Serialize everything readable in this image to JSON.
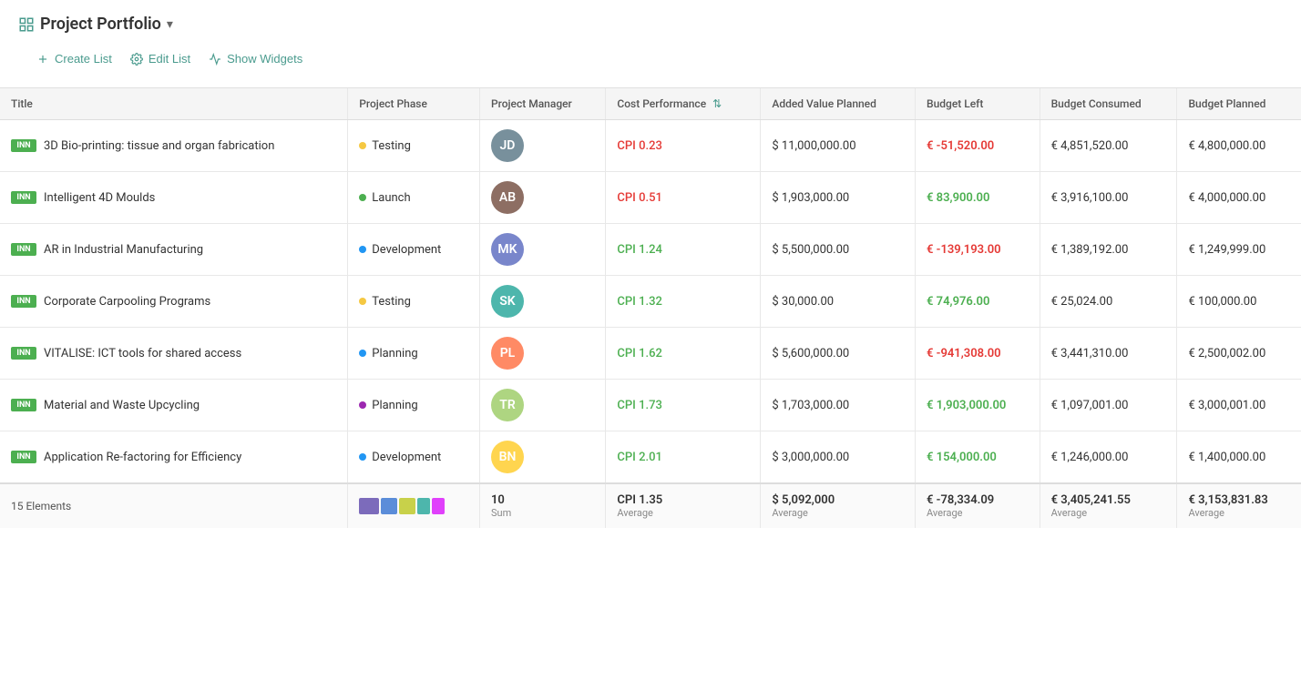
{
  "header": {
    "title": "Project Portfolio",
    "icon": "📋"
  },
  "toolbar": {
    "create_list": "Create List",
    "edit_list": "Edit List",
    "show_widgets": "Show Widgets"
  },
  "table": {
    "columns": [
      "Title",
      "Project Phase",
      "Project Manager",
      "Cost Performance",
      "Added Value Planned",
      "Budget Left",
      "Budget Consumed",
      "Budget Planned"
    ],
    "rows": [
      {
        "id": 1,
        "badge": "INN",
        "title": "3D Bio-printing: tissue and organ fabrication",
        "phase": "Testing",
        "phase_dot": "yellow",
        "cpi": "CPI 0.23",
        "cpi_color": "red",
        "added_value": "$ 11,000,000.00",
        "budget_left": "€ -51,520.00",
        "budget_left_color": "red",
        "budget_consumed": "€ 4,851,520.00",
        "budget_planned": "€ 4,800,000.00",
        "avatar_initials": "JD"
      },
      {
        "id": 2,
        "badge": "INN",
        "title": "Intelligent 4D Moulds",
        "phase": "Launch",
        "phase_dot": "green",
        "cpi": "CPI 0.51",
        "cpi_color": "red",
        "added_value": "$ 1,903,000.00",
        "budget_left": "€ 83,900.00",
        "budget_left_color": "green",
        "budget_consumed": "€ 3,916,100.00",
        "budget_planned": "€ 4,000,000.00",
        "avatar_initials": "AB"
      },
      {
        "id": 3,
        "badge": "INN",
        "title": "AR in Industrial Manufacturing",
        "phase": "Development",
        "phase_dot": "blue",
        "cpi": "CPI 1.24",
        "cpi_color": "green",
        "added_value": "$ 5,500,000.00",
        "budget_left": "€ -139,193.00",
        "budget_left_color": "red",
        "budget_consumed": "€ 1,389,192.00",
        "budget_planned": "€ 1,249,999.00",
        "avatar_initials": "MK"
      },
      {
        "id": 4,
        "badge": "INN",
        "title": "Corporate Carpooling Programs",
        "phase": "Testing",
        "phase_dot": "yellow",
        "cpi": "CPI 1.32",
        "cpi_color": "green",
        "added_value": "$ 30,000.00",
        "budget_left": "€ 74,976.00",
        "budget_left_color": "green",
        "budget_consumed": "€ 25,024.00",
        "budget_planned": "€ 100,000.00",
        "avatar_initials": "SK"
      },
      {
        "id": 5,
        "badge": "INN",
        "title": "VITALISE: ICT tools for shared access",
        "phase": "Planning",
        "phase_dot": "blue",
        "cpi": "CPI 1.62",
        "cpi_color": "green",
        "added_value": "$ 5,600,000.00",
        "budget_left": "€ -941,308.00",
        "budget_left_color": "red",
        "budget_consumed": "€ 3,441,310.00",
        "budget_planned": "€ 2,500,002.00",
        "avatar_initials": "PL"
      },
      {
        "id": 6,
        "badge": "INN",
        "title": "Material and Waste Upcycling",
        "phase": "Planning",
        "phase_dot": "purple",
        "cpi": "CPI 1.73",
        "cpi_color": "green",
        "added_value": "$ 1,703,000.00",
        "budget_left": "€ 1,903,000.00",
        "budget_left_color": "green",
        "budget_consumed": "€ 1,097,001.00",
        "budget_planned": "€ 3,000,001.00",
        "avatar_initials": "TR"
      },
      {
        "id": 7,
        "badge": "INN",
        "title": "Application Re-factoring for Efficiency",
        "phase": "Development",
        "phase_dot": "blue",
        "cpi": "CPI 2.01",
        "cpi_color": "green",
        "added_value": "$ 3,000,000.00",
        "budget_left": "€ 154,000.00",
        "budget_left_color": "green",
        "budget_consumed": "€ 1,246,000.00",
        "budget_planned": "€ 1,400,000.00",
        "avatar_initials": "BN"
      }
    ],
    "footer": {
      "elements_label": "15 Elements",
      "pm_count": "10",
      "pm_sub": "Sum",
      "cpi_avg": "CPI 1.35",
      "cpi_sub": "Average",
      "added_value_avg": "$ 5,092,000",
      "added_value_sub": "Average",
      "budget_left_avg": "€ -78,334.09",
      "budget_left_sub": "Average",
      "budget_consumed_avg": "€ 3,405,241.55",
      "budget_consumed_sub": "Average",
      "budget_planned_avg": "€ 3,153,831.83",
      "budget_planned_sub": "Average",
      "color_swatches": [
        "#7c6bbb",
        "#5b8dd9",
        "#c8d14a",
        "#4db6ac",
        "#e040fb"
      ]
    }
  }
}
